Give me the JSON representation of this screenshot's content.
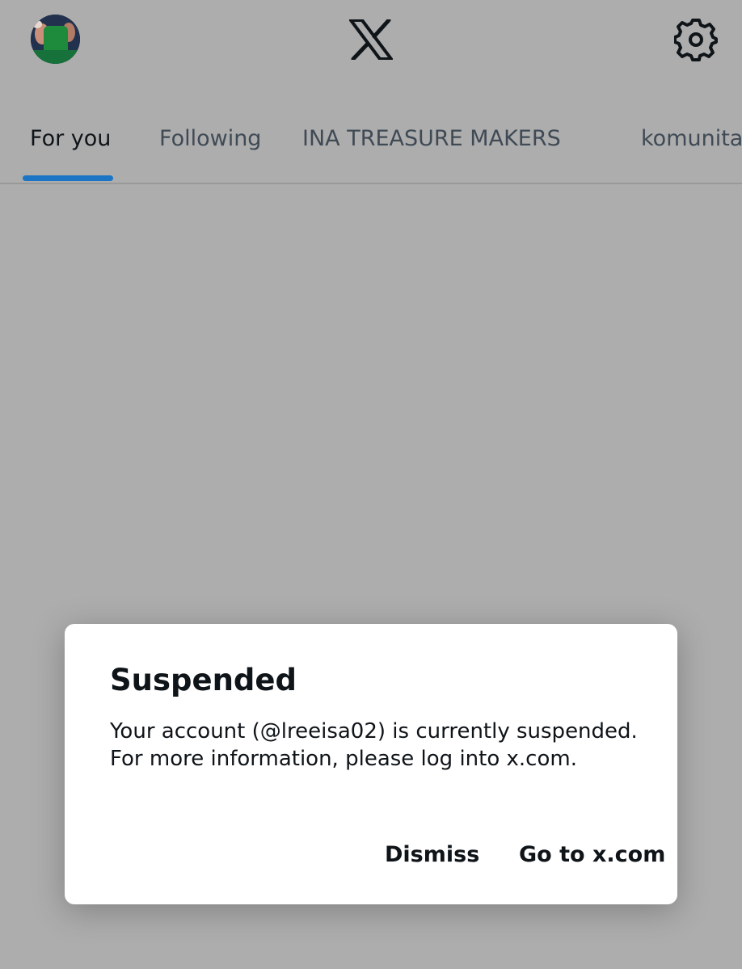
{
  "header": {
    "avatar_icon": "profile-avatar",
    "logo_icon": "x-logo-icon",
    "settings_icon": "gear-icon"
  },
  "tabs": [
    {
      "label": "For you",
      "active": true
    },
    {
      "label": "Following",
      "active": false
    },
    {
      "label": "INA TREASURE MAKERS",
      "active": false
    },
    {
      "label": "komunitas",
      "active": false
    }
  ],
  "dialog": {
    "title": "Suspended",
    "message_line1": "Your account (@lreeisa02) is currently suspended.",
    "message_line2": "For more information, please log into x.com.",
    "dismiss_label": "Dismiss",
    "goto_label": "Go to x.com"
  },
  "colors": {
    "overlay_background": "#adadad",
    "active_tab_indicator": "#1b74c4",
    "text_primary": "#0f1419",
    "dialog_background": "#ffffff"
  }
}
